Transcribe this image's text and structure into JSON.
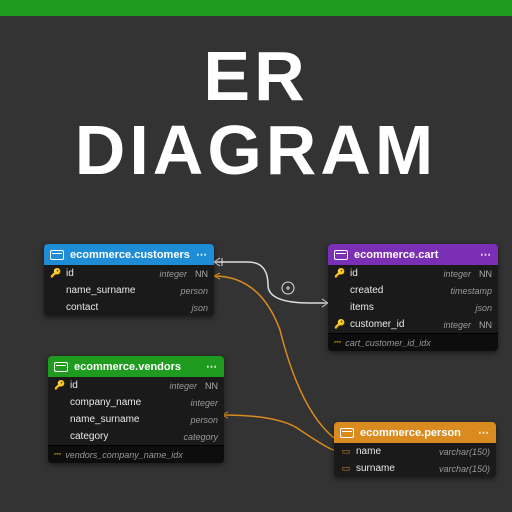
{
  "title_line1": "ER",
  "title_line2": "DIAGRAM",
  "tables": {
    "customers": {
      "header": "ecommerce.customers",
      "rows": [
        {
          "key": "pk",
          "name": "id",
          "type": "integer",
          "nn": "NN"
        },
        {
          "key": "",
          "name": "name_surname",
          "type": "person",
          "nn": ""
        },
        {
          "key": "",
          "name": "contact",
          "type": "json",
          "nn": ""
        }
      ]
    },
    "cart": {
      "header": "ecommerce.cart",
      "rows": [
        {
          "key": "pk",
          "name": "id",
          "type": "integer",
          "nn": "NN"
        },
        {
          "key": "",
          "name": "created",
          "type": "timestamp",
          "nn": ""
        },
        {
          "key": "",
          "name": "items",
          "type": "json",
          "nn": ""
        },
        {
          "key": "fk",
          "name": "customer_id",
          "type": "integer",
          "nn": "NN"
        }
      ],
      "index": "cart_customer_id_idx"
    },
    "vendors": {
      "header": "ecommerce.vendors",
      "rows": [
        {
          "key": "pk",
          "name": "id",
          "type": "integer",
          "nn": "NN"
        },
        {
          "key": "",
          "name": "company_name",
          "type": "integer",
          "nn": ""
        },
        {
          "key": "",
          "name": "name_surname",
          "type": "person",
          "nn": ""
        },
        {
          "key": "",
          "name": "category",
          "type": "category",
          "nn": ""
        }
      ],
      "index": "vendors_company_name_idx"
    },
    "person": {
      "header": "ecommerce.person",
      "rows": [
        {
          "key": "type",
          "name": "name",
          "type": "varchar(150)",
          "nn": ""
        },
        {
          "key": "type",
          "name": "surname",
          "type": "varchar(150)",
          "nn": ""
        }
      ]
    }
  },
  "chart_data": {
    "type": "er-diagram",
    "entities": [
      {
        "name": "ecommerce.customers",
        "color": "blue",
        "columns": [
          {
            "name": "id",
            "type": "integer",
            "pk": true,
            "nn": true
          },
          {
            "name": "name_surname",
            "type": "person"
          },
          {
            "name": "contact",
            "type": "json"
          }
        ]
      },
      {
        "name": "ecommerce.cart",
        "color": "purple",
        "columns": [
          {
            "name": "id",
            "type": "integer",
            "pk": true,
            "nn": true
          },
          {
            "name": "created",
            "type": "timestamp"
          },
          {
            "name": "items",
            "type": "json"
          },
          {
            "name": "customer_id",
            "type": "integer",
            "fk": true,
            "nn": true
          }
        ],
        "indexes": [
          "cart_customer_id_idx"
        ]
      },
      {
        "name": "ecommerce.vendors",
        "color": "green",
        "columns": [
          {
            "name": "id",
            "type": "integer",
            "pk": true,
            "nn": true
          },
          {
            "name": "company_name",
            "type": "integer"
          },
          {
            "name": "name_surname",
            "type": "person"
          },
          {
            "name": "category",
            "type": "category"
          }
        ],
        "indexes": [
          "vendors_company_name_idx"
        ]
      },
      {
        "name": "ecommerce.person",
        "color": "orange",
        "is_type": true,
        "columns": [
          {
            "name": "name",
            "type": "varchar(150)"
          },
          {
            "name": "surname",
            "type": "varchar(150)"
          }
        ]
      }
    ],
    "relationships": [
      {
        "from": "ecommerce.cart.customer_id",
        "to": "ecommerce.customers.id",
        "kind": "fk"
      },
      {
        "from": "ecommerce.customers.name_surname",
        "to": "ecommerce.person",
        "kind": "type-ref"
      },
      {
        "from": "ecommerce.vendors.name_surname",
        "to": "ecommerce.person",
        "kind": "type-ref"
      }
    ]
  }
}
